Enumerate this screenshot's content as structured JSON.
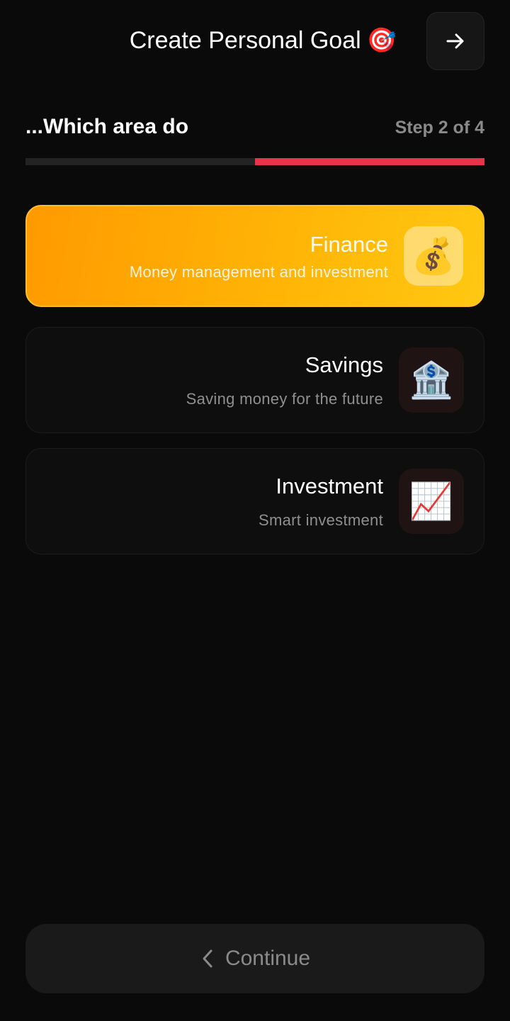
{
  "header": {
    "title": "Create Personal Goal",
    "title_emoji": "🎯",
    "next_icon": "arrow-right-icon"
  },
  "step": {
    "question": "...Which area do",
    "label": "Step 2 of 4",
    "current": 2,
    "total": 4,
    "progress_fraction": 0.5,
    "progress_color": "#e8344a"
  },
  "options": [
    {
      "title": "Finance",
      "description": "Money management and investment",
      "icon": "💰",
      "icon_name": "money-bag-icon",
      "selected": true
    },
    {
      "title": "Savings",
      "description": "Saving money for the future",
      "icon": "🏦",
      "icon_name": "bank-icon",
      "selected": false
    },
    {
      "title": "Investment",
      "description": "Smart investment",
      "icon": "📈",
      "icon_name": "chart-increasing-icon",
      "selected": false
    }
  ],
  "continue_button": {
    "label": "Continue",
    "icon": "chevron-left-icon",
    "enabled": false
  },
  "colors": {
    "background": "#0a0a0a",
    "accent": "#e8344a",
    "selected_gradient_start": "#ff9a00",
    "selected_gradient_end": "#ffc812"
  }
}
